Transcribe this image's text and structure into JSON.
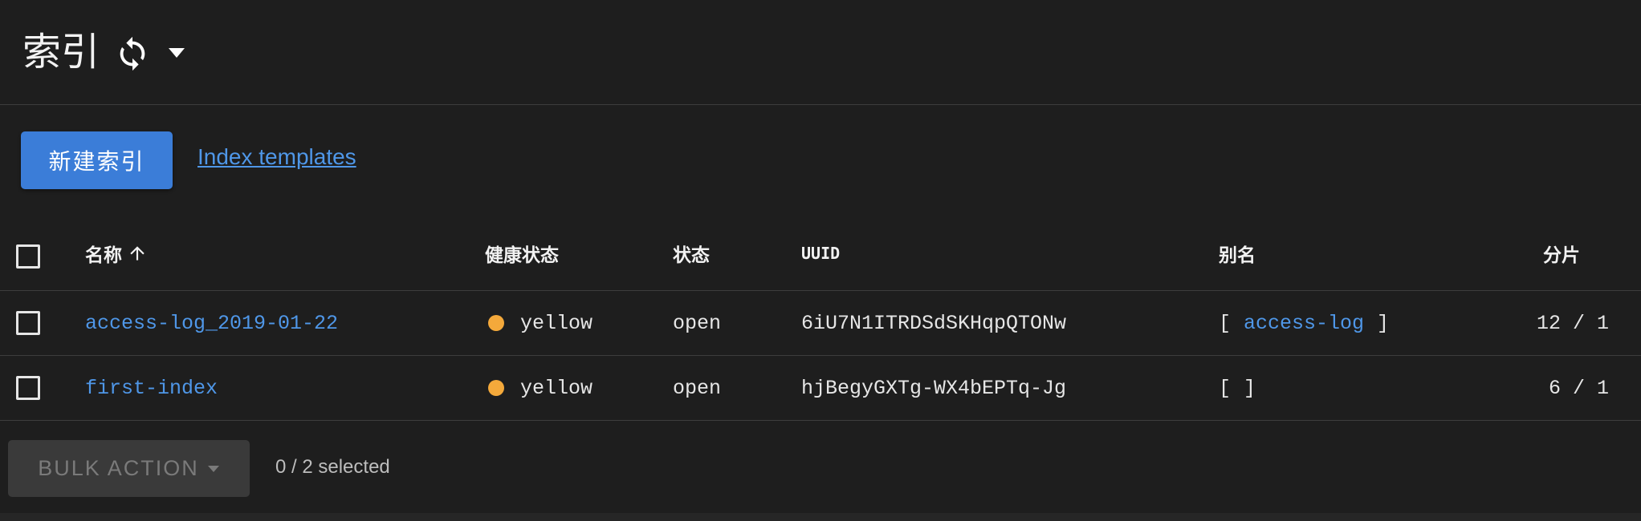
{
  "header": {
    "title": "索引",
    "refresh_icon": "refresh-icon",
    "dropdown_icon": "caret-down-icon"
  },
  "toolbar": {
    "new_index_label": "新建索引",
    "templates_link": "Index templates"
  },
  "table": {
    "columns": {
      "name": "名称",
      "health": "健康状态",
      "status": "状态",
      "uuid": "UUID",
      "aliases": "别名",
      "shards": "分片"
    },
    "sort": {
      "column": "name",
      "direction": "ascending",
      "icon": "arrow-up-icon"
    },
    "rows": [
      {
        "name": "access-log_2019-01-22",
        "health": "yellow",
        "status": "open",
        "uuid": "6iU7N1ITRDSdSKHqpQTONw",
        "alias_open": "[",
        "alias": "access-log",
        "alias_close": "]",
        "shards": "12 / 1"
      },
      {
        "name": "first-index",
        "health": "yellow",
        "status": "open",
        "uuid": "hjBegyGXTg-WX4bEPTq-Jg",
        "alias_open": "[",
        "alias": "",
        "alias_close": "]",
        "shards": "6 / 1"
      }
    ]
  },
  "footer": {
    "bulk_action_label": "BULK ACTION",
    "selected_text": "0 / 2 selected"
  },
  "colors": {
    "background": "#1e1e1e",
    "primary": "#3b7dd8",
    "link": "#4f97e8",
    "health_yellow": "#f4a93b"
  }
}
